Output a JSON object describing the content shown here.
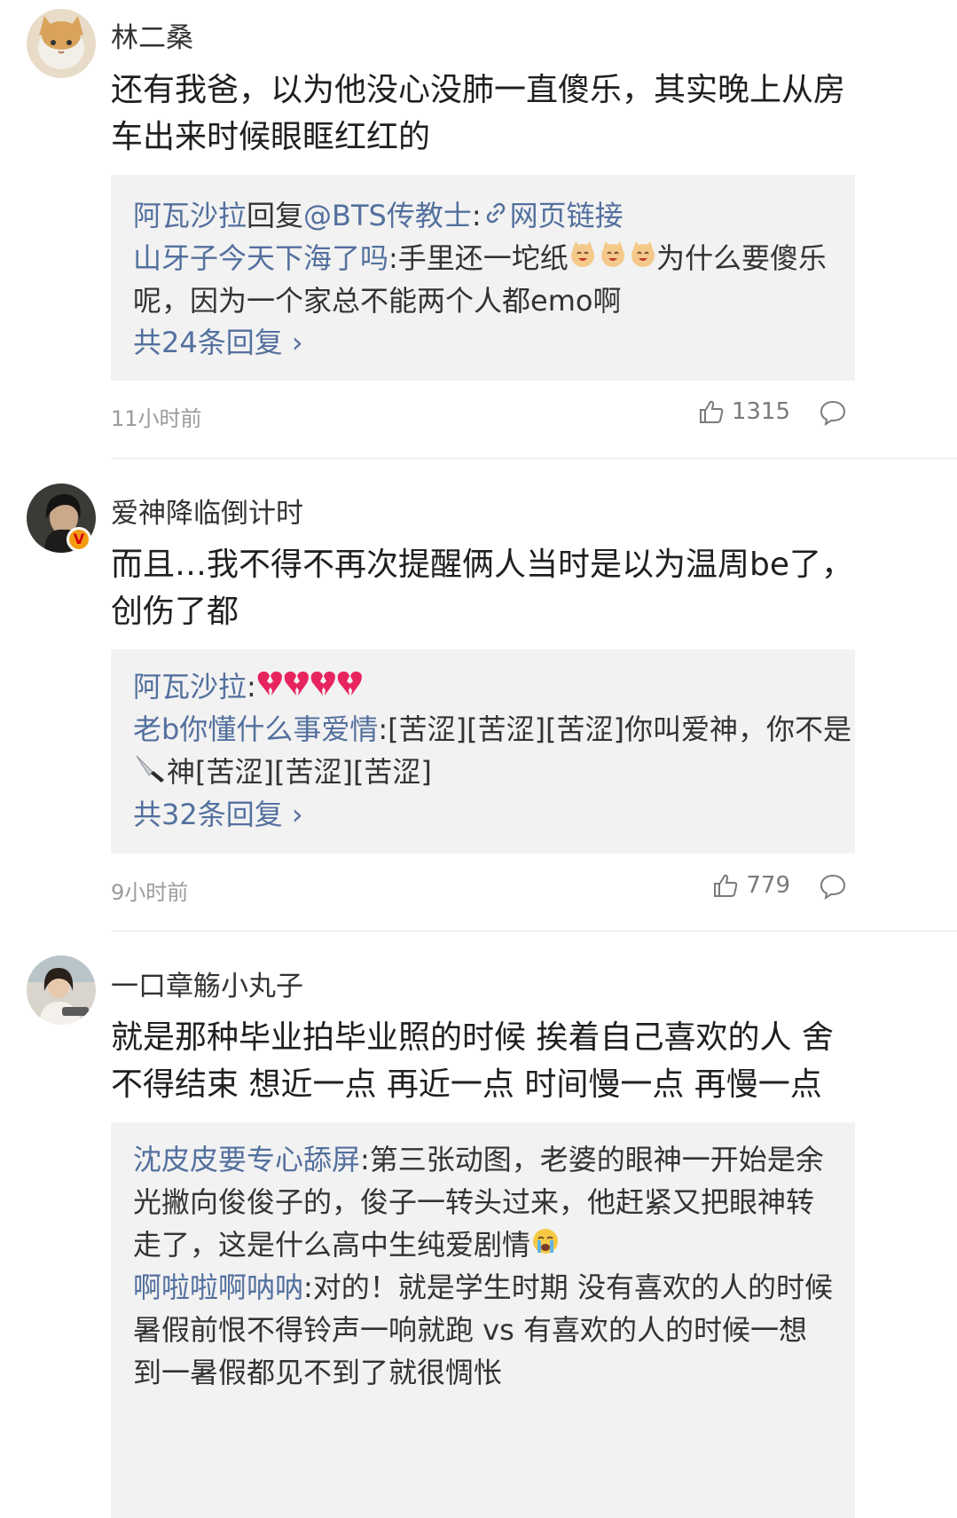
{
  "comments": [
    {
      "username": "林二桑",
      "text": "还有我爸，以为他没心没肺一直傻乐，其实晚上从房车出来时候眼眶红红的",
      "replies": [
        {
          "user": "阿瓦沙拉",
          "mid": "回复",
          "target": "@BTS传教士",
          "sep": ":",
          "link_icon": "link-icon",
          "link_text": "网页链接"
        },
        {
          "user": "山牙子今天下海了吗",
          "sep": ":",
          "text_a": "手里还一坨纸",
          "emoji": "laughing-cat-emoji",
          "text_b": "为什么要傻乐呢，因为一个家总不能两个人都emo啊"
        }
      ],
      "more_replies": "共24条回复",
      "time": "11小时前",
      "likes": "1315"
    },
    {
      "username": "爱神降临倒计时",
      "verified_badge": "V",
      "text": "而且…我不得不再次提醒俩人当时是以为温周be了，创伤了都",
      "replies": [
        {
          "user": "阿瓦沙拉",
          "sep": ":",
          "emoji": "broken-heart-emoji"
        },
        {
          "user": "老b你懂什么事爱情",
          "sep": ":",
          "text_a": "[苦涩][苦涩][苦涩]你叫爱神，你不是",
          "emoji": "knife-emoji",
          "text_b": "神[苦涩][苦涩][苦涩]"
        }
      ],
      "more_replies": "共32条回复",
      "time": "9小时前",
      "likes": "779"
    },
    {
      "username": "一口章觞小丸子",
      "text": "就是那种毕业拍毕业照的时候 挨着自己喜欢的人 舍不得结束 想近一点 再近一点 时间慢一点 再慢一点",
      "replies": [
        {
          "user": "沈皮皮要专心舔屏",
          "sep": ":",
          "text_a": "第三张动图，老婆的眼神一开始是余光撇向俊俊子的，俊子一转头过来，他赶紧又把眼神转走了，这是什么高中生纯爱剧情",
          "emoji": "crying-emoji"
        },
        {
          "user": "啊啦啦啊呐呐",
          "sep": ":",
          "text_a": "对的！就是学生时期 没有喜欢的人的时候 暑假前恨不得铃声一响就跑 vs 有喜欢的人的时候一想到一暑假都见不到了就很惆怅"
        }
      ]
    }
  ]
}
